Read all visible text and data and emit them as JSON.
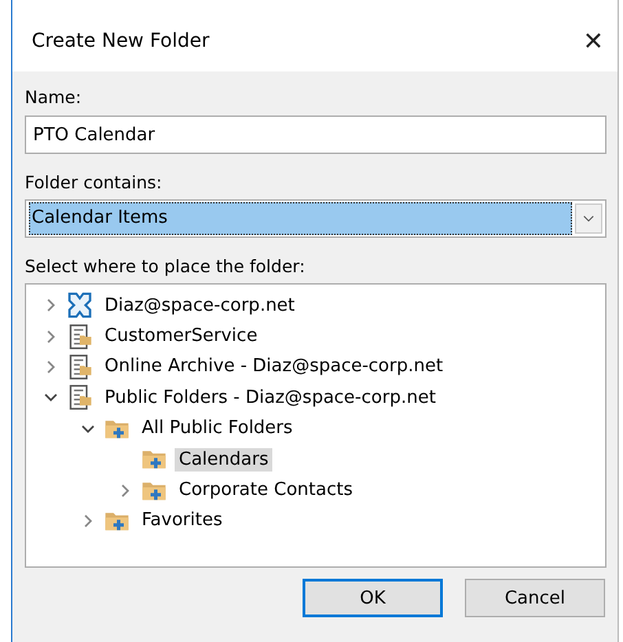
{
  "window": {
    "title": "Create New Folder",
    "close": "✕"
  },
  "name_field": {
    "label": "Name:",
    "value": "PTO Calendar"
  },
  "contains_field": {
    "label": "Folder contains:",
    "value": "Calendar Items"
  },
  "tree": {
    "label": "Select where to place the folder:",
    "items": [
      {
        "label": "Diaz@space-corp.net",
        "kind": "mailbox",
        "expanded": false,
        "selected": false
      },
      {
        "label": "CustomerService",
        "kind": "store",
        "expanded": false,
        "selected": false
      },
      {
        "label": "Online Archive - Diaz@space-corp.net",
        "kind": "store",
        "expanded": false,
        "selected": false
      },
      {
        "label": "Public Folders - Diaz@space-corp.net",
        "kind": "store",
        "expanded": true,
        "selected": false,
        "children": [
          {
            "label": "All Public Folders",
            "kind": "folder",
            "expanded": true,
            "selected": false,
            "children": [
              {
                "label": "Calendars",
                "kind": "folder",
                "selected": true
              },
              {
                "label": "Corporate Contacts",
                "kind": "folder",
                "expanded": false,
                "selected": false
              }
            ]
          },
          {
            "label": "Favorites",
            "kind": "folder",
            "expanded": false,
            "selected": false
          }
        ]
      }
    ]
  },
  "buttons": [
    {
      "label": "OK",
      "default": true
    },
    {
      "label": "Cancel",
      "default": false
    }
  ]
}
